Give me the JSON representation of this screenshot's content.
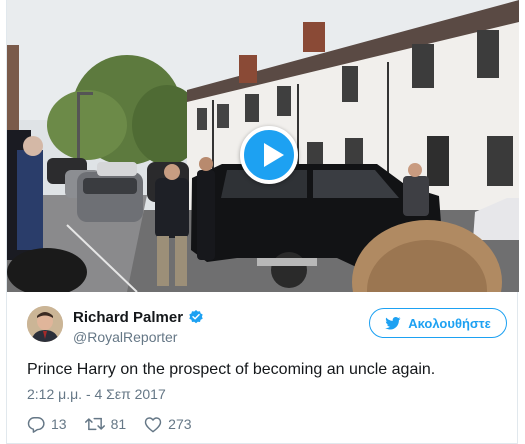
{
  "media": {
    "play_icon": "play-icon",
    "colors": {
      "play": "#1da1f2"
    }
  },
  "author": {
    "display_name": "Richard Palmer",
    "handle": "@RoyalReporter",
    "verified_icon": "verified-badge-icon"
  },
  "follow": {
    "label": "Ακολουθήστε",
    "icon": "twitter-bird-icon"
  },
  "tweet": {
    "text": "Prince Harry on the prospect of becoming an uncle again.",
    "timestamp": "2:12 μ.μ. - 4 Σεπ 2017"
  },
  "actions": {
    "replies": "13",
    "retweets": "81",
    "likes": "273"
  },
  "colors": {
    "accent": "#1da1f2",
    "muted": "#657786",
    "text": "#14171a"
  }
}
